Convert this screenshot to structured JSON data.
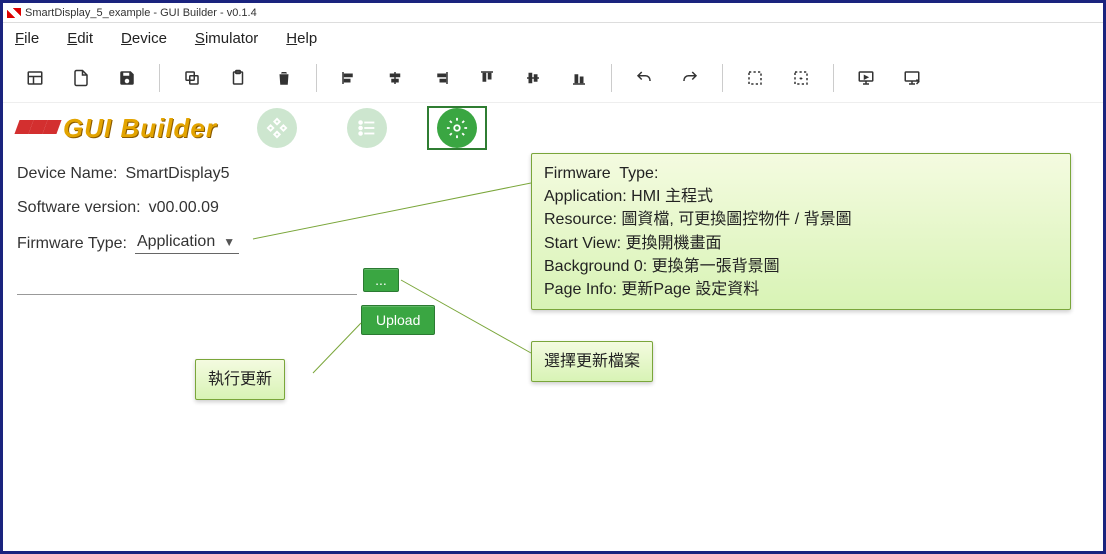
{
  "title": "SmartDisplay_5_example - GUI Builder - v0.1.4",
  "menubar": {
    "file": "File",
    "edit": "Edit",
    "device": "Device",
    "simulator": "Simulator",
    "help": "Help"
  },
  "brand": "GUI Builder",
  "info": {
    "device_label": "Device Name:",
    "device_value": "SmartDisplay5",
    "sw_label": "Software version:",
    "sw_value": "v00.00.09",
    "fw_label": "Firmware Type:",
    "fw_value": "Application"
  },
  "buttons": {
    "browse": "...",
    "upload": "Upload"
  },
  "callouts": {
    "fw_help": "Firmware  Type:\nApplication: HMI 主程式\nResource: 圖資檔, 可更換圖控物件 / 背景圖\nStart View: 更換開機畫面\nBackground 0: 更換第一張背景圖\nPage Info: 更新Page 設定資料",
    "select_file": "選擇更新檔案",
    "run_update": "執行更新"
  }
}
